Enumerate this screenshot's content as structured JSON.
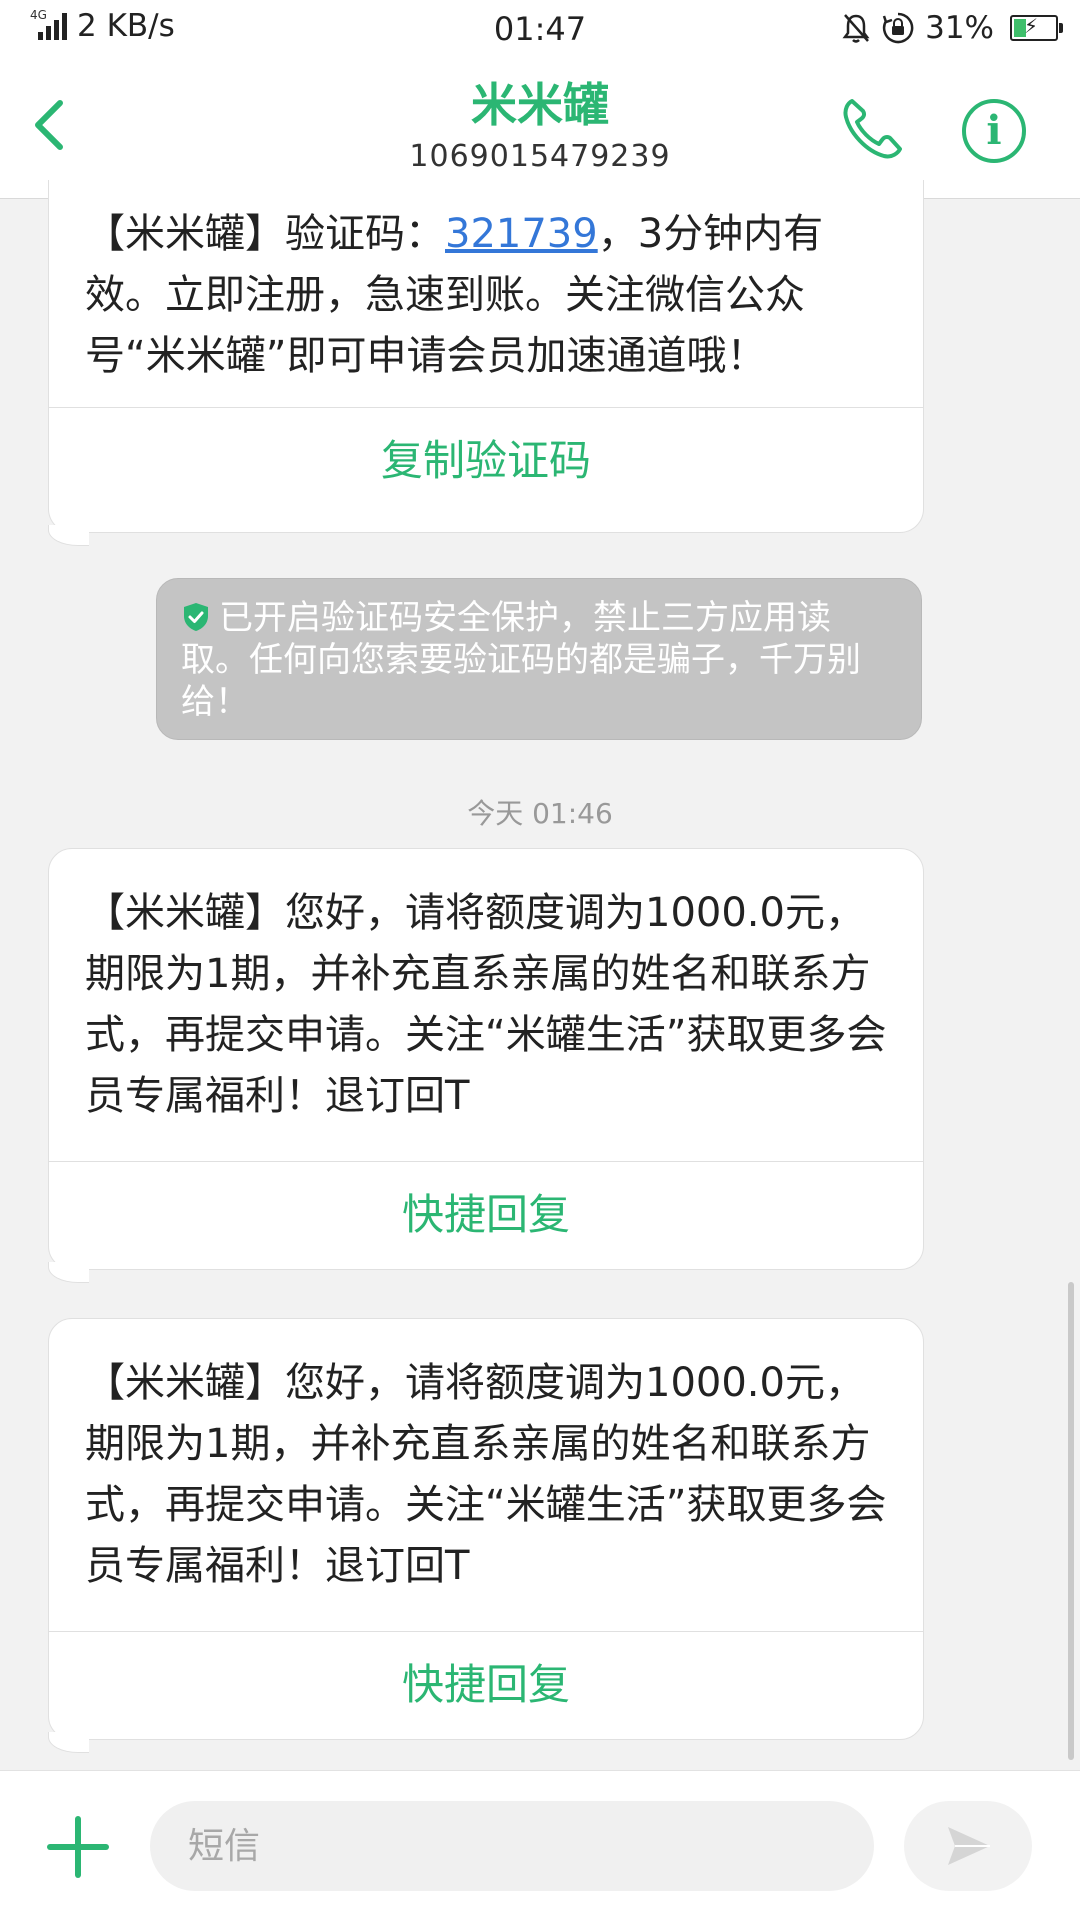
{
  "status_bar": {
    "network_type": "4G",
    "speed": "2 KB/s",
    "time": "01:47",
    "battery": "31%",
    "battery_level": 0.31,
    "icons": [
      "signal-icon",
      "mute-bell-icon",
      "rotation-lock-icon",
      "battery-charging-icon"
    ]
  },
  "header": {
    "contact_name": "米米罐",
    "contact_number": "1069015479239",
    "icons": [
      "back-icon",
      "phone-icon",
      "info-icon"
    ]
  },
  "messages": [
    {
      "text_prefix": "【米米罐】验证码：",
      "code": "321739",
      "text_suffix": "，3分钟内有效。立即注册，急速到账。关注微信公众号“米米罐”即可申请会员加速通道哦！",
      "action": "复制验证码"
    },
    {
      "text": "【米米罐】您好，请将额度调为1000.0元，期限为1期，并补充直系亲属的姓名和联系方式，再提交申请。关注“米罐生活”获取更多会员专属福利！退订回T",
      "action": "快捷回复"
    },
    {
      "text": "【米米罐】您好，请将额度调为1000.0元，期限为1期，并补充直系亲属的姓名和联系方式，再提交申请。关注“米罐生活”获取更多会员专属福利！退订回T",
      "action": "快捷回复"
    }
  ],
  "security_notice": {
    "text": "已开启验证码安全保护，禁止三方应用读取。任何向您索要验证码的都是骗子，千万别给！",
    "icon": "shield-check-icon"
  },
  "timestamp": "今天 01:46",
  "composer": {
    "placeholder": "短信",
    "icons": [
      "plus-icon",
      "send-icon"
    ]
  },
  "colors": {
    "accent": "#2bb673",
    "link": "#3477d8",
    "notice_bg": "#c4c4c4",
    "background": "#f2f2f2"
  }
}
